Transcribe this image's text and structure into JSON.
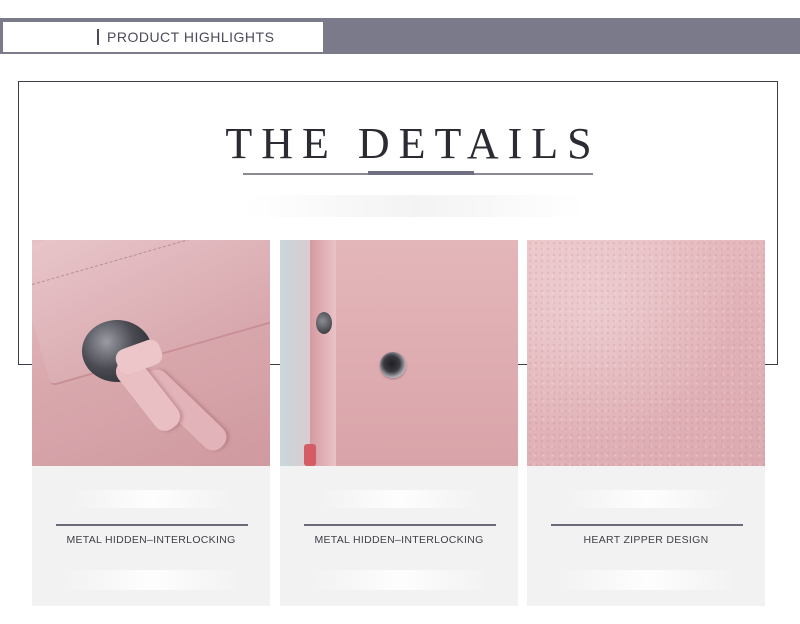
{
  "header": {
    "section_label": "PRODUCT HIGHLIGHTS",
    "bar_color": "#7b7a8b"
  },
  "title": {
    "text": "THE DETAILS"
  },
  "details": [
    {
      "caption": "METAL HIDDEN–INTERLOCKING",
      "photo": "pink-bag-flap-metal-clasp"
    },
    {
      "caption": "METAL HIDDEN–INTERLOCKING",
      "photo": "pink-bag-inner-snap-button"
    },
    {
      "caption": "HEART ZIPPER DESIGN",
      "photo": "pink-leather-texture"
    }
  ]
}
